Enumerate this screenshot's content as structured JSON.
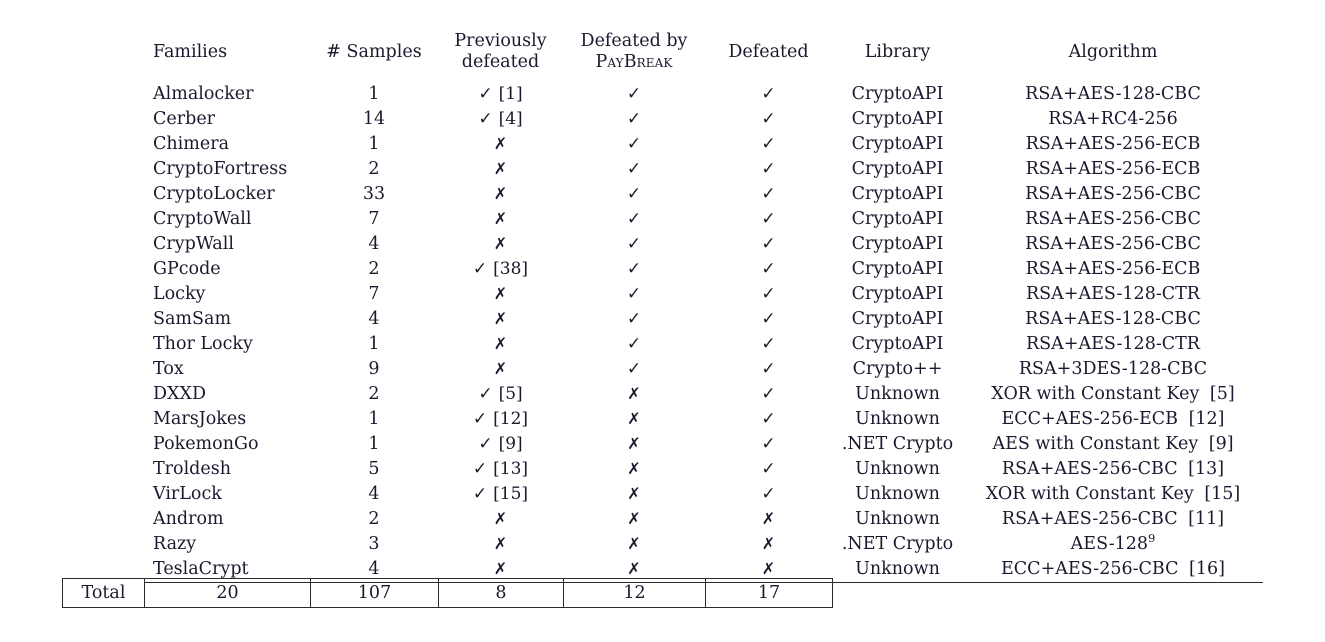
{
  "table": {
    "headers": [
      {
        "line1": "Families",
        "line2": ""
      },
      {
        "line1": "# Samples",
        "line2": ""
      },
      {
        "line1": "Previously",
        "line2": "defeated"
      },
      {
        "line1": "Defeated by",
        "line2": "PayBreak"
      },
      {
        "line1": "Defeated",
        "line2": ""
      },
      {
        "line1": "Library",
        "line2": ""
      },
      {
        "line1": "Algorithm",
        "line2": ""
      }
    ],
    "marks": {
      "check": "✓",
      "cross": "✗"
    },
    "group1": [
      {
        "family": "Almalocker",
        "samples": "1",
        "prev": "check",
        "prev_cite": "[1]",
        "paybreak": "check",
        "defeated": "check",
        "library": "CryptoAPI",
        "algorithm": "RSA+AES-128-CBC",
        "alg_cite": ""
      },
      {
        "family": "Cerber",
        "samples": "14",
        "prev": "check",
        "prev_cite": "[4]",
        "paybreak": "check",
        "defeated": "check",
        "library": "CryptoAPI",
        "algorithm": "RSA+RC4-256",
        "alg_cite": ""
      },
      {
        "family": "Chimera",
        "samples": "1",
        "prev": "cross",
        "prev_cite": "",
        "paybreak": "check",
        "defeated": "check",
        "library": "CryptoAPI",
        "algorithm": "RSA+AES-256-ECB",
        "alg_cite": ""
      },
      {
        "family": "CryptoFortress",
        "samples": "2",
        "prev": "cross",
        "prev_cite": "",
        "paybreak": "check",
        "defeated": "check",
        "library": "CryptoAPI",
        "algorithm": "RSA+AES-256-ECB",
        "alg_cite": ""
      },
      {
        "family": "CryptoLocker",
        "samples": "33",
        "prev": "cross",
        "prev_cite": "",
        "paybreak": "check",
        "defeated": "check",
        "library": "CryptoAPI",
        "algorithm": "RSA+AES-256-CBC",
        "alg_cite": ""
      },
      {
        "family": "CryptoWall",
        "samples": "7",
        "prev": "cross",
        "prev_cite": "",
        "paybreak": "check",
        "defeated": "check",
        "library": "CryptoAPI",
        "algorithm": "RSA+AES-256-CBC",
        "alg_cite": ""
      },
      {
        "family": "CrypWall",
        "samples": "4",
        "prev": "cross",
        "prev_cite": "",
        "paybreak": "check",
        "defeated": "check",
        "library": "CryptoAPI",
        "algorithm": "RSA+AES-256-CBC",
        "alg_cite": ""
      },
      {
        "family": "GPcode",
        "samples": "2",
        "prev": "check",
        "prev_cite": "[38]",
        "paybreak": "check",
        "defeated": "check",
        "library": "CryptoAPI",
        "algorithm": "RSA+AES-256-ECB",
        "alg_cite": ""
      },
      {
        "family": "Locky",
        "samples": "7",
        "prev": "cross",
        "prev_cite": "",
        "paybreak": "check",
        "defeated": "check",
        "library": "CryptoAPI",
        "algorithm": "RSA+AES-128-CTR",
        "alg_cite": ""
      },
      {
        "family": "SamSam",
        "samples": "4",
        "prev": "cross",
        "prev_cite": "",
        "paybreak": "check",
        "defeated": "check",
        "library": "CryptoAPI",
        "algorithm": "RSA+AES-128-CBC",
        "alg_cite": ""
      },
      {
        "family": "Thor Locky",
        "samples": "1",
        "prev": "cross",
        "prev_cite": "",
        "paybreak": "check",
        "defeated": "check",
        "library": "CryptoAPI",
        "algorithm": "RSA+AES-128-CTR",
        "alg_cite": ""
      },
      {
        "family": "Tox",
        "samples": "9",
        "prev": "cross",
        "prev_cite": "",
        "paybreak": "check",
        "defeated": "check",
        "library": "Crypto++",
        "algorithm": "RSA+3DES-128-CBC",
        "alg_cite": ""
      }
    ],
    "group2": [
      {
        "family": "DXXD",
        "samples": "2",
        "prev": "check",
        "prev_cite": "[5]",
        "paybreak": "cross",
        "defeated": "check",
        "library": "Unknown",
        "algorithm": "XOR with Constant Key",
        "alg_cite": "[5]"
      },
      {
        "family": "MarsJokes",
        "samples": "1",
        "prev": "check",
        "prev_cite": "[12]",
        "paybreak": "cross",
        "defeated": "check",
        "library": "Unknown",
        "algorithm": "ECC+AES-256-ECB",
        "alg_cite": "[12]"
      },
      {
        "family": "PokemonGo",
        "samples": "1",
        "prev": "check",
        "prev_cite": "[9]",
        "paybreak": "cross",
        "defeated": "check",
        "library": ".NET Crypto",
        "algorithm": "AES with Constant Key",
        "alg_cite": "[9]"
      },
      {
        "family": "Troldesh",
        "samples": "5",
        "prev": "check",
        "prev_cite": "[13]",
        "paybreak": "cross",
        "defeated": "check",
        "library": "Unknown",
        "algorithm": "RSA+AES-256-CBC",
        "alg_cite": "[13]"
      },
      {
        "family": "VirLock",
        "samples": "4",
        "prev": "check",
        "prev_cite": "[15]",
        "paybreak": "cross",
        "defeated": "check",
        "library": "Unknown",
        "algorithm": "XOR with Constant Key",
        "alg_cite": "[15]"
      },
      {
        "family": "Androm",
        "samples": "2",
        "prev": "cross",
        "prev_cite": "",
        "paybreak": "cross",
        "defeated": "cross",
        "library": "Unknown",
        "algorithm": "RSA+AES-256-CBC",
        "alg_cite": "[11]"
      },
      {
        "family": "Razy",
        "samples": "3",
        "prev": "cross",
        "prev_cite": "",
        "paybreak": "cross",
        "defeated": "cross",
        "library": ".NET Crypto",
        "algorithm": "AES-128",
        "alg_cite": "",
        "alg_footnote": "9"
      },
      {
        "family": "TeslaCrypt",
        "samples": "4",
        "prev": "cross",
        "prev_cite": "",
        "paybreak": "cross",
        "defeated": "cross",
        "library": "Unknown",
        "algorithm": "ECC+AES-256-CBC",
        "alg_cite": "[16]"
      }
    ],
    "total": {
      "label": "Total",
      "families": "20",
      "samples": "107",
      "prev": "8",
      "paybreak": "12",
      "defeated": "17"
    }
  }
}
